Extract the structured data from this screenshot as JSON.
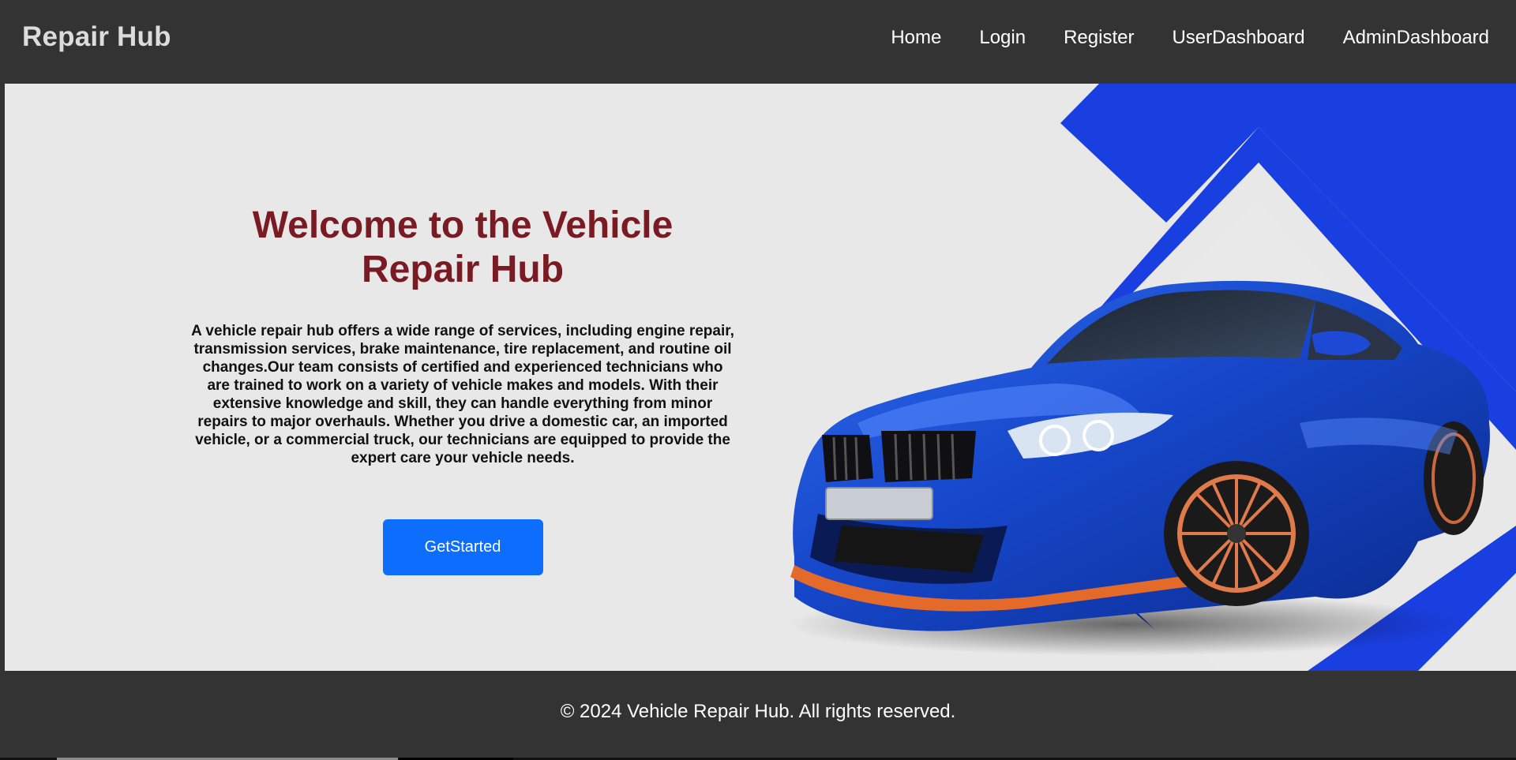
{
  "header": {
    "brand": "Repair Hub",
    "nav": [
      {
        "label": "Home"
      },
      {
        "label": "Login"
      },
      {
        "label": "Register"
      },
      {
        "label": "UserDashboard"
      },
      {
        "label": "AdminDashboard"
      }
    ]
  },
  "hero": {
    "title": "Welcome to the Vehicle Repair Hub",
    "description": "A vehicle repair hub offers a wide range of services, including engine repair, transmission services, brake maintenance, tire replacement, and routine oil changes.Our team consists of certified and experienced technicians who are trained to work on a variety of vehicle makes and models. With their extensive knowledge and skill, they can handle everything from minor repairs to major overhauls. Whether you drive a domestic car, an imported vehicle, or a commercial truck, our technicians are equipped to provide the expert care your vehicle needs.",
    "cta_label": "GetStarted"
  },
  "footer": {
    "copyright": "© 2024 Vehicle Repair Hub. All rights reserved."
  },
  "colors": {
    "header_bg": "#333333",
    "hero_bg": "#e8e8e8",
    "title": "#7a1a22",
    "accent_blue": "#1a3fe0",
    "button": "#0d6efd"
  }
}
